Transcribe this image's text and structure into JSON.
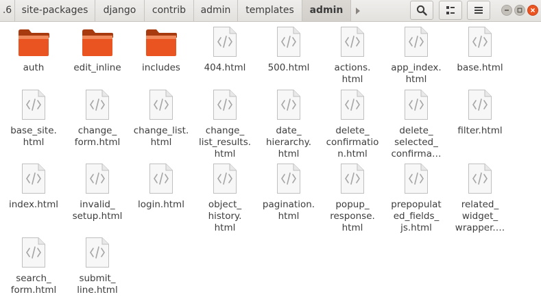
{
  "toolbar": {
    "breadcrumbs": [
      ".6",
      "site-packages",
      "django",
      "contrib",
      "admin",
      "templates",
      "admin"
    ],
    "forward_icon": "chevron-right-icon",
    "search_icon": "search-icon",
    "view_icon": "view-options-icon",
    "menu_icon": "menu-icon",
    "window_controls": [
      "minimize",
      "maximize",
      "close"
    ]
  },
  "colors": {
    "folder": "#e95420",
    "file_icon": "#bfbfbf",
    "close_button": "#e95420"
  },
  "files": [
    {
      "type": "folder",
      "name": "auth"
    },
    {
      "type": "folder",
      "name": "edit_inline"
    },
    {
      "type": "folder",
      "name": "includes"
    },
    {
      "type": "html",
      "name": "404.html"
    },
    {
      "type": "html",
      "name": "500.html"
    },
    {
      "type": "html",
      "name": "actions.\nhtml"
    },
    {
      "type": "html",
      "name": "app_index.\nhtml"
    },
    {
      "type": "html",
      "name": "base.html"
    },
    {
      "type": "html",
      "name": "base_site.\nhtml"
    },
    {
      "type": "html",
      "name": "change_\nform.html"
    },
    {
      "type": "html",
      "name": "change_list.\nhtml"
    },
    {
      "type": "html",
      "name": "change_\nlist_results.\nhtml"
    },
    {
      "type": "html",
      "name": "date_\nhierarchy.\nhtml"
    },
    {
      "type": "html",
      "name": "delete_\nconfirmatio\nn.html"
    },
    {
      "type": "html",
      "name": "delete_\nselected_\nconfirma…"
    },
    {
      "type": "html",
      "name": "filter.html"
    },
    {
      "type": "html",
      "name": "index.html"
    },
    {
      "type": "html",
      "name": "invalid_\nsetup.html"
    },
    {
      "type": "html",
      "name": "login.html"
    },
    {
      "type": "html",
      "name": "object_\nhistory.\nhtml"
    },
    {
      "type": "html",
      "name": "pagination.\nhtml"
    },
    {
      "type": "html",
      "name": "popup_\nresponse.\nhtml"
    },
    {
      "type": "html",
      "name": "prepopulat\ned_fields_\njs.html"
    },
    {
      "type": "html",
      "name": "related_\nwidget_\nwrapper.…"
    },
    {
      "type": "html",
      "name": "search_\nform.html"
    },
    {
      "type": "html",
      "name": "submit_\nline.html"
    }
  ]
}
